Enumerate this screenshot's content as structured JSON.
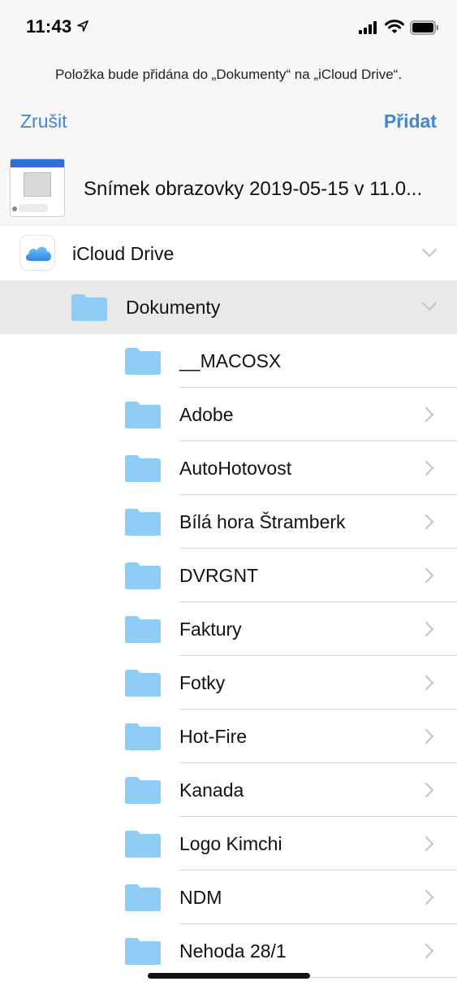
{
  "status_bar": {
    "time": "11:43",
    "icons": [
      "location-arrow-icon",
      "signal-icon",
      "wifi-icon",
      "battery-icon"
    ]
  },
  "header": {
    "info": "Položka bude přidána do „Dokumenty“ na „iCloud Drive“.",
    "cancel_label": "Zrušit",
    "add_label": "Přidat"
  },
  "file": {
    "name": "Snímek obrazovky 2019-05-15 v 11.0..."
  },
  "locations": {
    "root": "iCloud Drive",
    "current": "Dokumenty"
  },
  "folders": [
    {
      "name": "__MACOSX",
      "has_children": false
    },
    {
      "name": "Adobe",
      "has_children": true
    },
    {
      "name": "AutoHotovost",
      "has_children": true
    },
    {
      "name": "Bílá hora Štramberk",
      "has_children": true
    },
    {
      "name": "DVRGNT",
      "has_children": true
    },
    {
      "name": "Faktury",
      "has_children": true
    },
    {
      "name": "Fotky",
      "has_children": true
    },
    {
      "name": "Hot-Fire",
      "has_children": true
    },
    {
      "name": "Kanada",
      "has_children": true
    },
    {
      "name": "Logo Kimchi",
      "has_children": true
    },
    {
      "name": "NDM",
      "has_children": true
    },
    {
      "name": "Nehoda 28/1",
      "has_children": true
    }
  ],
  "colors": {
    "accent": "#3d86d8",
    "folder": "#8fcdf5",
    "selected_row": "#e9e9e9"
  }
}
